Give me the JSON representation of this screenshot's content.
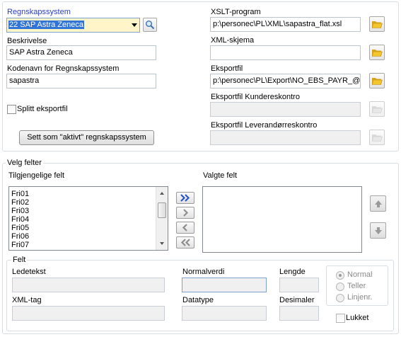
{
  "top": {
    "regnskapssystem_label": "Regnskapssystem",
    "regnskapssystem_value": "22 SAP Astra Zeneca",
    "beskrivelse_label": "Beskrivelse",
    "beskrivelse_value": "SAP Astra Zeneca",
    "kodenavn_label": "Kodenavn for Regnskapssystem",
    "kodenavn_value": "sapastra",
    "splitt_label": "Splitt eksportfil",
    "set_active_label": "Sett som \"aktivt\" regnskapssystem",
    "xslt_label": "XSLT-program",
    "xslt_value": "p:\\personec\\PL\\XML\\sapastra_flat.xsl",
    "xmlskjema_label": "XML-skjema",
    "xmlskjema_value": "",
    "eksportfil_label": "Eksportfil",
    "eksportfil_value": "p:\\personec\\PL\\Export\\NO_EBS_PAYR_@",
    "kunde_label": "Eksportfil Kundereskontro",
    "leverandor_label": "Eksportfil Leverandørreskontro"
  },
  "felter": {
    "group_title": "Velg felter",
    "available_label": "Tilgjengelige felt",
    "selected_label": "Valgte felt",
    "available_items": [
      "Fri01",
      "Fri02",
      "Fri03",
      "Fri04",
      "Fri05",
      "Fri06",
      "Fri07"
    ],
    "selected_items": [],
    "move_all_right": "»",
    "move_right": "›",
    "move_left": "‹",
    "move_all_left": "«"
  },
  "felt": {
    "group_title": "Felt",
    "ledetekst_label": "Ledetekst",
    "normalverdi_label": "Normalverdi",
    "lengde_label": "Lengde",
    "xmltag_label": "XML-tag",
    "datatype_label": "Datatype",
    "desimaler_label": "Desimaler",
    "radio_normal": "Normal",
    "radio_teller": "Teller",
    "radio_linjenr": "Linjenr.",
    "lukket_label": "Lukket"
  },
  "colors": {
    "accent_blue": "#2a3ec0",
    "selection_bg": "#3375d6",
    "folder_yellow": "#f2c531"
  },
  "icons": {
    "search": "search-icon",
    "folder": "folder-open-icon",
    "up": "arrow-up-icon",
    "down": "arrow-down-icon"
  }
}
